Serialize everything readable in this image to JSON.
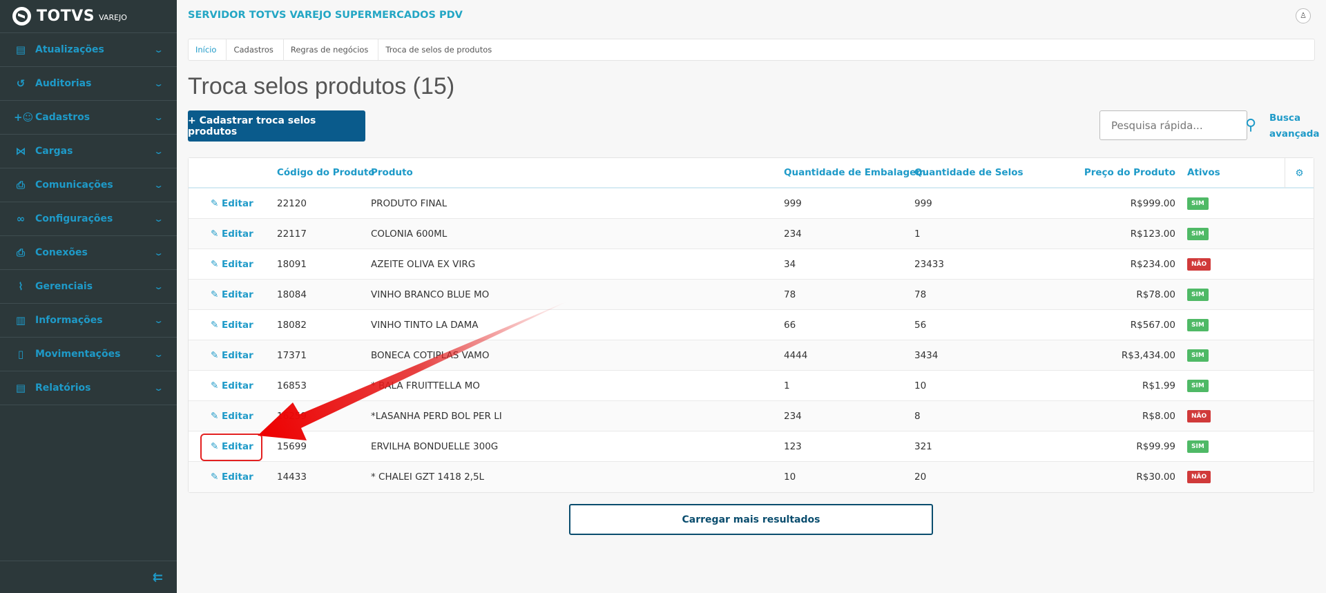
{
  "sidebar": {
    "logo": "TOTVS",
    "logo_sub": "VAREJO",
    "items": [
      {
        "label": "Atualizações",
        "icon": "server-icon",
        "glyph": "▤"
      },
      {
        "label": "Auditorias",
        "icon": "history-icon",
        "glyph": "↺"
      },
      {
        "label": "Cadastros",
        "icon": "add-user-icon",
        "glyph": "+☺"
      },
      {
        "label": "Cargas",
        "icon": "share-icon",
        "glyph": "⋈"
      },
      {
        "label": "Comunicações",
        "icon": "file-upload-icon",
        "glyph": "⎙"
      },
      {
        "label": "Configurações",
        "icon": "link-icon",
        "glyph": "∞"
      },
      {
        "label": "Conexões",
        "icon": "file-sync-icon",
        "glyph": "⎙"
      },
      {
        "label": "Gerenciais",
        "icon": "chart-icon",
        "glyph": "⌇"
      },
      {
        "label": "Informações",
        "icon": "building-icon",
        "glyph": "▥"
      },
      {
        "label": "Movimentações",
        "icon": "clipboard-icon",
        "glyph": "▯"
      },
      {
        "label": "Relatórios",
        "icon": "document-icon",
        "glyph": "▤"
      }
    ],
    "collapse_glyph": "⇇"
  },
  "header": {
    "server": "SERVIDOR TOTVS VAREJO SUPERMERCADOS PDV",
    "avatar": "♙"
  },
  "breadcrumb": [
    "Início",
    "Cadastros",
    "Regras de negócios",
    "Troca de selos de produtos"
  ],
  "page": {
    "title": "Troca selos produtos (15)",
    "add_button": "+  Cadastrar troca selos produtos",
    "search_placeholder": "Pesquisa rápida...",
    "advanced_1": "Busca",
    "advanced_2": "avançada",
    "load_more": "Carregar mais resultados"
  },
  "table": {
    "columns": [
      "",
      "Código do Produto",
      "Produto",
      "Quantidade de Embalagem",
      "Quantidade de Selos",
      "Preço do Produto",
      "Ativos"
    ],
    "edit_label": "✎ Editar",
    "rows": [
      [
        "22120",
        "PRODUTO FINAL",
        "999",
        "999",
        "R$999.00",
        "SIM"
      ],
      [
        "22117",
        "COLONIA 600ML",
        "234",
        "1",
        "R$123.00",
        "SIM"
      ],
      [
        "18091",
        "AZEITE OLIVA EX VIRG",
        "34",
        "23433",
        "R$234.00",
        "NÃO"
      ],
      [
        "18084",
        "VINHO BRANCO BLUE MO",
        "78",
        "78",
        "R$78.00",
        "SIM"
      ],
      [
        "18082",
        "VINHO TINTO LA DAMA",
        "66",
        "56",
        "R$567.00",
        "SIM"
      ],
      [
        "17371",
        "BONECA COTIPLAS VAMO",
        "4444",
        "3434",
        "R$3,434.00",
        "SIM"
      ],
      [
        "16853",
        "* BALA FRUITTELLA MO",
        "1",
        "10",
        "R$1.99",
        "SIM"
      ],
      [
        "16259",
        "*LASANHA PERD BOL PER LI",
        "234",
        "8",
        "R$8.00",
        "NÃO"
      ],
      [
        "15699",
        "ERVILHA BONDUELLE 300G",
        "123",
        "321",
        "R$99.99",
        "SIM"
      ],
      [
        "14433",
        "* CHALEI GZT 1418 2,5L",
        "10",
        "20",
        "R$30.00",
        "NÃO"
      ]
    ]
  },
  "colors": {
    "sidebar": "#2c383a",
    "accent": "#1e9ac8",
    "primary": "#0a5b8c",
    "sim": "#4fb966",
    "nao": "#d03a3a",
    "annotation": "#e32020"
  }
}
